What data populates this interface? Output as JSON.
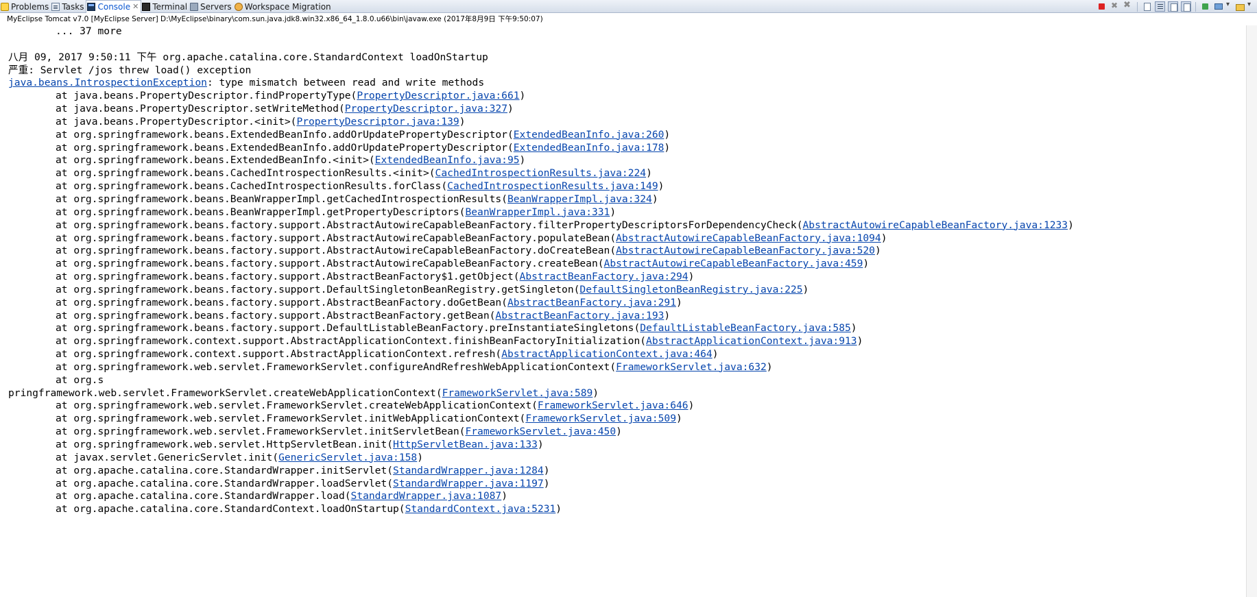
{
  "tabs": [
    {
      "label": "Problems",
      "icon": "problems-icon",
      "active": false
    },
    {
      "label": "Tasks",
      "icon": "tasks-icon",
      "active": false
    },
    {
      "label": "Console",
      "icon": "console-icon",
      "active": true
    },
    {
      "label": "Terminal",
      "icon": "terminal-icon",
      "active": false
    },
    {
      "label": "Servers",
      "icon": "servers-icon",
      "active": false
    },
    {
      "label": "Workspace Migration",
      "icon": "migration-icon",
      "active": false
    }
  ],
  "toolbar": [
    "terminate-icon",
    "remove-launch-icon",
    "remove-all-terminated-icon",
    "clear-console-icon",
    "scroll-lock-icon",
    "show-console-on-stdout-icon",
    "show-console-on-stderr-icon",
    "pin-console-icon",
    "display-selected-console-icon",
    "open-console-icon",
    "view-menu-icon"
  ],
  "colors": {
    "link": "#0645ad",
    "accent": "#0b57d0",
    "terminate": "#dd2222"
  },
  "launch_description": "MyEclipse Tomcat v7.0 [MyEclipse Server] D:\\MyEclipse\\binary\\com.sun.java.jdk8.win32.x86_64_1.8.0.u66\\bin\\javaw.exe (2017年8月9日 下午9:50:07)",
  "console": {
    "header_lines": [
      {
        "indent": true,
        "text": "... 37 more",
        "link": "",
        "tail": ""
      },
      {
        "indent": false,
        "text": "",
        "link": "",
        "tail": ""
      },
      {
        "indent": false,
        "text": "八月 09, 2017 9:50:11 下午 org.apache.catalina.core.StandardContext loadOnStartup",
        "link": "",
        "tail": ""
      },
      {
        "indent": false,
        "text": "严重: Servlet /jos threw load() exception",
        "link": "",
        "tail": ""
      },
      {
        "indent": false,
        "text": "",
        "link": "java.beans.IntrospectionException",
        "tail": ": type mismatch between read and write methods"
      }
    ],
    "frames": [
      {
        "indent": true,
        "text": "at java.beans.PropertyDescriptor.findPropertyType(",
        "link": "PropertyDescriptor.java:661",
        "tail": ")"
      },
      {
        "indent": true,
        "text": "at java.beans.PropertyDescriptor.setWriteMethod(",
        "link": "PropertyDescriptor.java:327",
        "tail": ")"
      },
      {
        "indent": true,
        "text": "at java.beans.PropertyDescriptor.<init>(",
        "link": "PropertyDescriptor.java:139",
        "tail": ")"
      },
      {
        "indent": true,
        "text": "at org.springframework.beans.ExtendedBeanInfo.addOrUpdatePropertyDescriptor(",
        "link": "ExtendedBeanInfo.java:260",
        "tail": ")"
      },
      {
        "indent": true,
        "text": "at org.springframework.beans.ExtendedBeanInfo.addOrUpdatePropertyDescriptor(",
        "link": "ExtendedBeanInfo.java:178",
        "tail": ")"
      },
      {
        "indent": true,
        "text": "at org.springframework.beans.ExtendedBeanInfo.<init>(",
        "link": "ExtendedBeanInfo.java:95",
        "tail": ")"
      },
      {
        "indent": true,
        "text": "at org.springframework.beans.CachedIntrospectionResults.<init>(",
        "link": "CachedIntrospectionResults.java:224",
        "tail": ")"
      },
      {
        "indent": true,
        "text": "at org.springframework.beans.CachedIntrospectionResults.forClass(",
        "link": "CachedIntrospectionResults.java:149",
        "tail": ")"
      },
      {
        "indent": true,
        "text": "at org.springframework.beans.BeanWrapperImpl.getCachedIntrospectionResults(",
        "link": "BeanWrapperImpl.java:324",
        "tail": ")"
      },
      {
        "indent": true,
        "text": "at org.springframework.beans.BeanWrapperImpl.getPropertyDescriptors(",
        "link": "BeanWrapperImpl.java:331",
        "tail": ")"
      },
      {
        "indent": true,
        "text": "at org.springframework.beans.factory.support.AbstractAutowireCapableBeanFactory.filterPropertyDescriptorsForDependencyCheck(",
        "link": "AbstractAutowireCapableBeanFactory.java:1233",
        "tail": ")"
      },
      {
        "indent": true,
        "text": "at org.springframework.beans.factory.support.AbstractAutowireCapableBeanFactory.populateBean(",
        "link": "AbstractAutowireCapableBeanFactory.java:1094",
        "tail": ")"
      },
      {
        "indent": true,
        "text": "at org.springframework.beans.factory.support.AbstractAutowireCapableBeanFactory.doCreateBean(",
        "link": "AbstractAutowireCapableBeanFactory.java:520",
        "tail": ")"
      },
      {
        "indent": true,
        "text": "at org.springframework.beans.factory.support.AbstractAutowireCapableBeanFactory.createBean(",
        "link": "AbstractAutowireCapableBeanFactory.java:459",
        "tail": ")"
      },
      {
        "indent": true,
        "text": "at org.springframework.beans.factory.support.AbstractBeanFactory$1.getObject(",
        "link": "AbstractBeanFactory.java:294",
        "tail": ")"
      },
      {
        "indent": true,
        "text": "at org.springframework.beans.factory.support.DefaultSingletonBeanRegistry.getSingleton(",
        "link": "DefaultSingletonBeanRegistry.java:225",
        "tail": ")"
      },
      {
        "indent": true,
        "text": "at org.springframework.beans.factory.support.AbstractBeanFactory.doGetBean(",
        "link": "AbstractBeanFactory.java:291",
        "tail": ")"
      },
      {
        "indent": true,
        "text": "at org.springframework.beans.factory.support.AbstractBeanFactory.getBean(",
        "link": "AbstractBeanFactory.java:193",
        "tail": ")"
      },
      {
        "indent": true,
        "text": "at org.springframework.beans.factory.support.DefaultListableBeanFactory.preInstantiateSingletons(",
        "link": "DefaultListableBeanFactory.java:585",
        "tail": ")"
      },
      {
        "indent": true,
        "text": "at org.springframework.context.support.AbstractApplicationContext.finishBeanFactoryInitialization(",
        "link": "AbstractApplicationContext.java:913",
        "tail": ")"
      },
      {
        "indent": true,
        "text": "at org.springframework.context.support.AbstractApplicationContext.refresh(",
        "link": "AbstractApplicationContext.java:464",
        "tail": ")"
      },
      {
        "indent": true,
        "text": "at org.springframework.web.servlet.FrameworkServlet.configureAndRefreshWebApplicationContext(",
        "link": "FrameworkServlet.java:632",
        "tail": ")"
      },
      {
        "indent": true,
        "text": "at org.s",
        "link": "",
        "tail": ""
      },
      {
        "indent": false,
        "text": "pringframework.web.servlet.FrameworkServlet.createWebApplicationContext(",
        "link": "FrameworkServlet.java:589",
        "tail": ")"
      },
      {
        "indent": true,
        "text": "at org.springframework.web.servlet.FrameworkServlet.createWebApplicationContext(",
        "link": "FrameworkServlet.java:646",
        "tail": ")"
      },
      {
        "indent": true,
        "text": "at org.springframework.web.servlet.FrameworkServlet.initWebApplicationContext(",
        "link": "FrameworkServlet.java:509",
        "tail": ")"
      },
      {
        "indent": true,
        "text": "at org.springframework.web.servlet.FrameworkServlet.initServletBean(",
        "link": "FrameworkServlet.java:450",
        "tail": ")"
      },
      {
        "indent": true,
        "text": "at org.springframework.web.servlet.HttpServletBean.init(",
        "link": "HttpServletBean.java:133",
        "tail": ")"
      },
      {
        "indent": true,
        "text": "at javax.servlet.GenericServlet.init(",
        "link": "GenericServlet.java:158",
        "tail": ")"
      },
      {
        "indent": true,
        "text": "at org.apache.catalina.core.StandardWrapper.initServlet(",
        "link": "StandardWrapper.java:1284",
        "tail": ")"
      },
      {
        "indent": true,
        "text": "at org.apache.catalina.core.StandardWrapper.loadServlet(",
        "link": "StandardWrapper.java:1197",
        "tail": ")"
      },
      {
        "indent": true,
        "text": "at org.apache.catalina.core.StandardWrapper.load(",
        "link": "StandardWrapper.java:1087",
        "tail": ")"
      },
      {
        "indent": true,
        "text": "at org.apache.catalina.core.StandardContext.loadOnStartup(",
        "link": "StandardContext.java:5231",
        "tail": ")"
      }
    ]
  }
}
